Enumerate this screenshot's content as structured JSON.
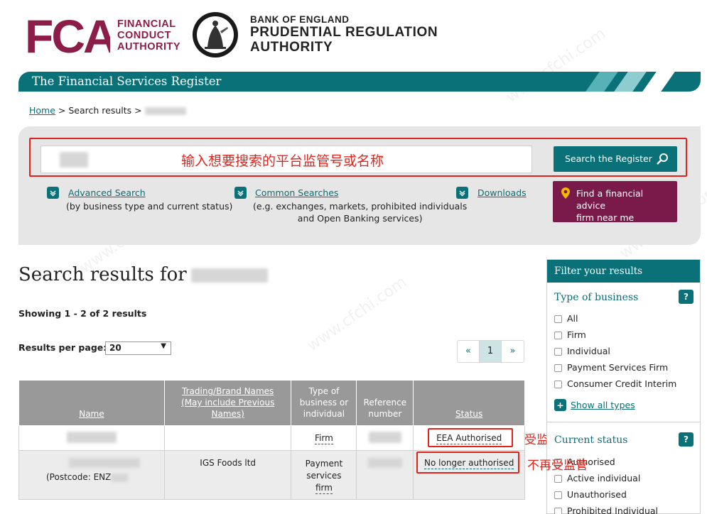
{
  "header": {
    "fca_mark": "FCA",
    "fca_lines": [
      "FINANCIAL",
      "CONDUCT",
      "AUTHORITY"
    ],
    "pra_line1": "BANK OF ENGLAND",
    "pra_line2": "PRUDENTIAL REGULATION",
    "pra_line3": "AUTHORITY"
  },
  "banner": {
    "title": "The Financial Services Register"
  },
  "breadcrumb": {
    "home": "Home",
    "sep": ">",
    "current": "Search results",
    "sep2": ">"
  },
  "search": {
    "annotation": "输入想要搜索的平台监管号或名称",
    "button_label": "Search the Register",
    "advanced_label": "Advanced Search",
    "advanced_desc": "(by business type and current status)",
    "common_label": "Common Searches",
    "common_desc_1": "(e.g. exchanges, markets, prohibited individuals",
    "common_desc_2": "and Open Banking services)",
    "downloads_label": "Downloads",
    "advice_line1": "Find a financial advice",
    "advice_line2": "firm near me"
  },
  "results": {
    "title_prefix": "Search results for",
    "showing": "Showing 1 - 2 of 2 results",
    "per_page_label": "Results per page:",
    "per_page_value": "20",
    "pager_prev": "«",
    "pager_current": "1",
    "pager_next": "»",
    "columns": {
      "name": "Name",
      "trading_1": "Trading/Brand Names",
      "trading_2": "(May include Previous",
      "trading_3": "Names)",
      "type_1": "Type of",
      "type_2": "business or",
      "type_3": "individual",
      "ref_1": "Reference",
      "ref_2": "number",
      "status": "Status"
    },
    "rows": [
      {
        "trading": "",
        "type": "Firm",
        "status": "EEA Authorised"
      },
      {
        "name_prefix": "(Postcode: ENZ",
        "trading": "IGS Foods ltd",
        "type_1": "Payment",
        "type_2": "services",
        "type_3": "firm",
        "status": "No longer authorised"
      }
    ],
    "annotation_1": "受监管中",
    "annotation_2": "不再受监管"
  },
  "filter": {
    "title": "Filter your results",
    "type_title": "Type of business",
    "help": "?",
    "types": [
      "All",
      "Firm",
      "Individual",
      "Payment Services Firm",
      "Consumer Credit Interim"
    ],
    "show_all": "Show all types",
    "status_title": "Current status",
    "statuses": [
      "Authorised",
      "Active individual",
      "Unauthorised",
      "Prohibited Individual"
    ]
  },
  "watermark": "www.cfchi.com",
  "colors": {
    "teal": "#0b7178",
    "burgundy": "#7a1a4a",
    "fca_purple": "#8c1d48",
    "red": "#e0241c"
  }
}
